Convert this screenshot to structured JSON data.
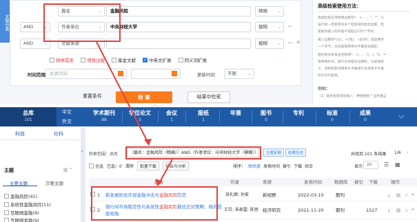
{
  "advanced_search": {
    "category_tab": "文献分类",
    "rows": [
      {
        "field": "篇名",
        "value": "金融风险",
        "match": "精确"
      },
      {
        "logic": "AND",
        "field": "作者单位",
        "value": "中央财经大学",
        "match": "模糊"
      },
      {
        "logic": "AND",
        "field": "文献来源",
        "value": "",
        "match": "模糊"
      }
    ],
    "options": [
      {
        "label": "网络首发",
        "checked": false,
        "red": true
      },
      {
        "label": "增强出版",
        "checked": false,
        "red": true
      },
      {
        "label": "基金文献",
        "checked": false,
        "red": false
      },
      {
        "label": "中英文扩展",
        "checked": true,
        "red": false
      },
      {
        "label": "同义词扩展",
        "checked": false,
        "red": false
      }
    ],
    "time_range_label": "时间范围：",
    "publish_time_placeholder": "发表时间",
    "update_time_label": "更新时间",
    "update_time_value": "不限",
    "reset_label": "重置条件",
    "search_label": "检 索",
    "result_search_label": "结果中检索"
  },
  "help": {
    "title": "高级检索使用方法：",
    "lines": [
      "高级检索支持使用运算符*、+、-、''、\"\"、()",
      "进行同一检索项内多个检索词的组合运算，检",
      "索框内输入的内容不得超过120个字符。",
      "输入运算符*(与)、+(或)、-(非)时，前后要空",
      "一个字节，优先级需用英文半角括号确定。",
      "若检索词本身含空格或*、+、-、()、/、%、=",
      "等特殊符号，进行多词组合运算时，为避免歧",
      "义，须将检索词用英文半角单引号或英文半角",
      "双引号引起来。",
      "例如：",
      "（1）篇名检索项后输入：神经网络 * 自然语言"
    ]
  },
  "tabs": [
    {
      "label": "总库",
      "count": "101",
      "active": true
    },
    {
      "label": "中文",
      "count": "",
      "active": false
    },
    {
      "label": "外文",
      "count": "",
      "active": false
    },
    {
      "label": "学术期刊",
      "count": "88"
    },
    {
      "label": "学位论文",
      "count": "5"
    },
    {
      "label": "会议",
      "count": "1"
    },
    {
      "label": "报纸",
      "count": "1"
    },
    {
      "label": "年鉴",
      "count": ""
    },
    {
      "label": "图书",
      "count": "0"
    },
    {
      "label": "专利",
      "count": ""
    },
    {
      "label": "标准",
      "count": "0"
    },
    {
      "label": "成果",
      "count": "0"
    }
  ],
  "sidebar": {
    "tabs": [
      "科技",
      "社科"
    ],
    "section_title": "主题",
    "subtabs": [
      "主要主题",
      "次要主题"
    ],
    "facets": [
      {
        "label": "金融风险(41)"
      },
      {
        "label": "系统性金融风险(11)"
      },
      {
        "label": "互联网金融(9)"
      },
      {
        "label": "互联网金融(9)"
      }
    ]
  },
  "results": {
    "crumb": "检索范围：总库",
    "query": "（篇名：金融风险（精确））AND（作者单位：中央财经大学（模糊））",
    "pill_subscribe": "主题定制",
    "pill_history": "检索历史",
    "total": "共找到 101 条结果",
    "page": "1/6",
    "toolbar": {
      "select_all": "全选",
      "selected": "已选：0",
      "clear": "清除",
      "batch_download": "批量下载",
      "export": "导出与分析",
      "sort_label": "排序：",
      "sort_options": [
        "相关度",
        "发表时间",
        "被引",
        "下载",
        "综合"
      ],
      "display": "显示",
      "display_count": "20"
    },
    "columns": [
      "题名",
      "作者",
      "来源",
      "发表时间",
      "数据库",
      "被引",
      "下载",
      "操作"
    ],
    "rows": [
      {
        "num": "1",
        "title_pre": "新发展阶段外部金融冲击与",
        "title_kw": "金融风险",
        "title_post": "防范",
        "author": "张礼卿; 孙俊",
        "source": "新视野",
        "date": "2022-03-10",
        "db": "期刊",
        "cited": "",
        "downloads": ""
      },
      {
        "num": "2",
        "title_pre": "银行间市场稳定性与系统性",
        "title_kw": "金融风险",
        "title_post": "最优应对策略：政府投股视角",
        "author": "王甘; 朱家雷; 陈思",
        "source": "经济研究",
        "date": "2021-11-20",
        "db": "期刊",
        "cited": "",
        "downloads": "1527"
      }
    ]
  }
}
